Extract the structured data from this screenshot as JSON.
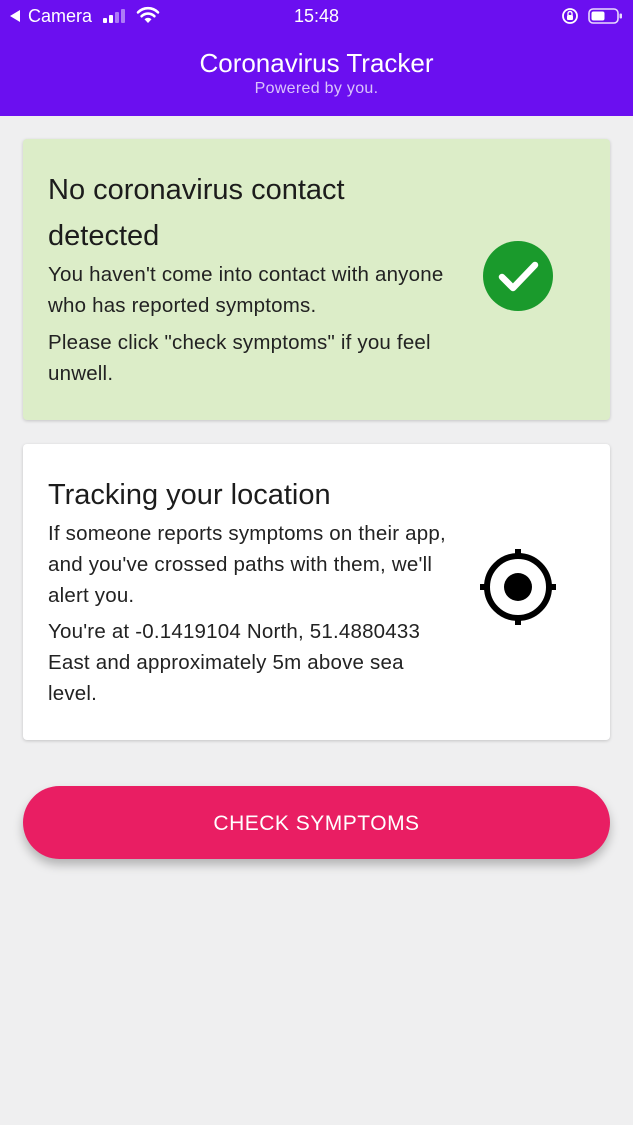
{
  "status_bar": {
    "back_app": "Camera",
    "time": "15:48"
  },
  "header": {
    "title": "Coronavirus Tracker",
    "subtitle": "Powered by you."
  },
  "contact_card": {
    "title": "No coronavirus contact detected",
    "line1": "You haven't come into contact with anyone who has reported symptoms.",
    "line2": "Please click \"check symptoms\" if you feel unwell.",
    "icon": "check-circle-icon",
    "accent_color": "#1a9a2c",
    "background_color": "#dcedc8"
  },
  "location_card": {
    "title": "Tracking your location",
    "line1": "If someone reports symptoms on their app, and you've crossed paths with them, we'll alert you.",
    "line2": "You're at -0.1419104 North, 51.4880433 East and approximately 5m above sea level.",
    "icon": "gps-target-icon"
  },
  "actions": {
    "check_symptoms_label": "CHECK SYMPTOMS",
    "button_color": "#e91e63"
  },
  "colors": {
    "header_bg": "#6b0ff0",
    "page_bg": "#efeff0"
  }
}
